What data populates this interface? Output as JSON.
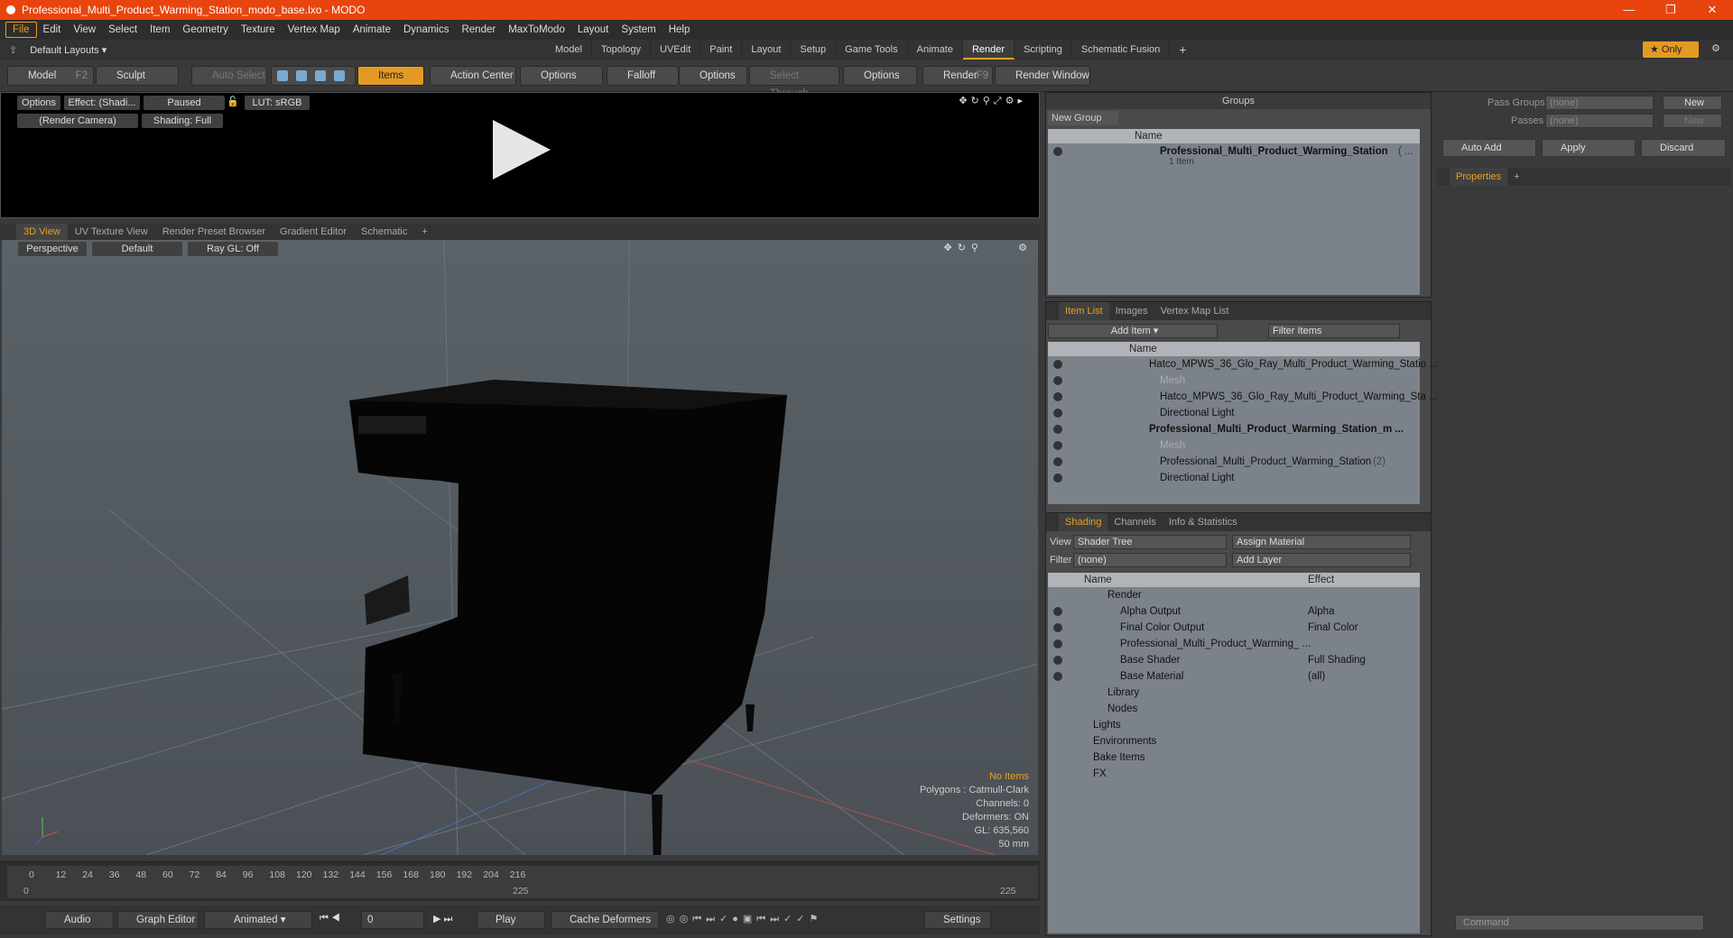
{
  "window": {
    "title": "Professional_Multi_Product_Warming_Station_modo_base.lxo - MODO"
  },
  "menu": [
    "File",
    "Edit",
    "View",
    "Select",
    "Item",
    "Geometry",
    "Texture",
    "Vertex Map",
    "Animate",
    "Dynamics",
    "Render",
    "MaxToModo",
    "Layout",
    "System",
    "Help"
  ],
  "layouts": {
    "label": "Default Layouts ▾",
    "tabs": [
      "Model",
      "Topology",
      "UVEdit",
      "Paint",
      "Layout",
      "Setup",
      "Game Tools",
      "Animate",
      "Render",
      "Scripting",
      "Schematic Fusion"
    ],
    "active": "Render",
    "only_label": "Only"
  },
  "toolbar": {
    "model": "Model",
    "model_key": "F2",
    "sculpt": "Sculpt",
    "auto_select": "Auto Select",
    "items": "Items",
    "action_center": "Action Center",
    "options1": "Options",
    "falloff": "Falloff",
    "options2": "Options",
    "select_through": "Select Through",
    "options3": "Options",
    "render": "Render",
    "render_key": "F9",
    "render_window": "Render Window"
  },
  "preview": {
    "options": "Options",
    "effect": "Effect: (Shadi...",
    "paused": "Paused",
    "lut": "LUT: sRGB",
    "camera": "(Render Camera)",
    "shading": "Shading: Full"
  },
  "viewtabs": [
    "3D View",
    "UV Texture View",
    "Render Preset Browser",
    "Gradient Editor",
    "Schematic"
  ],
  "view3d": {
    "perspective": "Perspective",
    "default": "Default",
    "raygl": "Ray GL: Off"
  },
  "stats": {
    "no_items": "No Items",
    "polygons": "Polygons : Catmull-Clark",
    "channels": "Channels: 0",
    "deformers": "Deformers: ON",
    "gl": "GL: 635,560",
    "lens": "50 mm"
  },
  "timeline": {
    "ticks": [
      "0",
      "12",
      "24",
      "36",
      "48",
      "60",
      "72",
      "84",
      "96",
      "108",
      "120",
      "132",
      "144",
      "156",
      "168",
      "180",
      "192",
      "204",
      "216"
    ],
    "start": "0",
    "mid": "225",
    "end": "225"
  },
  "bottom": {
    "audio": "Audio",
    "graph_editor": "Graph Editor",
    "animated": "Animated",
    "frame": "0",
    "play": "Play",
    "cache": "Cache Deformers",
    "settings": "Settings"
  },
  "groups": {
    "title": "Groups",
    "new_group": "New Group",
    "col_name": "Name",
    "item_name": "Professional_Multi_Product_Warming_Station",
    "item_suffix": "( ...",
    "item_count": "1 Item"
  },
  "itemlist": {
    "tabs": [
      "Item List",
      "Images",
      "Vertex Map List"
    ],
    "add_item": "Add Item",
    "filter": "Filter Items",
    "col_name": "Name",
    "rows": [
      {
        "label": "Hatco_MPWS_36_Glo_Ray_Multi_Product_Warming_Statio ...",
        "indent": 1,
        "bold": false,
        "dim": false
      },
      {
        "label": "Mesh",
        "indent": 2,
        "bold": false,
        "dim": true
      },
      {
        "label": "Hatco_MPWS_36_Glo_Ray_Multi_Product_Warming_Sta ...",
        "indent": 2,
        "bold": false,
        "dim": false
      },
      {
        "label": "Directional Light",
        "indent": 2,
        "bold": false,
        "dim": false
      },
      {
        "label": "Professional_Multi_Product_Warming_Station_m ...",
        "indent": 1,
        "bold": true,
        "dim": false
      },
      {
        "label": "Mesh",
        "indent": 2,
        "bold": false,
        "dim": true
      },
      {
        "label": "Professional_Multi_Product_Warming_Station",
        "indent": 2,
        "bold": false,
        "dim": false,
        "suffix": "(2)"
      },
      {
        "label": "Directional Light",
        "indent": 2,
        "bold": false,
        "dim": false
      }
    ]
  },
  "shading": {
    "tabs": [
      "Shading",
      "Channels",
      "Info & Statistics"
    ],
    "view_label": "View",
    "view_value": "Shader Tree",
    "assign": "Assign Material",
    "filter_label": "Filter",
    "filter_value": "(none)",
    "add_layer": "Add Layer",
    "col_name": "Name",
    "col_effect": "Effect",
    "rows": [
      {
        "name": "Render",
        "effect": "",
        "indent": 1
      },
      {
        "name": "Alpha Output",
        "effect": "Alpha",
        "indent": 2
      },
      {
        "name": "Final Color Output",
        "effect": "Final Color",
        "indent": 2
      },
      {
        "name": "Professional_Multi_Product_Warming_ ...",
        "effect": "",
        "indent": 2
      },
      {
        "name": "Base Shader",
        "effect": "Full Shading",
        "indent": 2
      },
      {
        "name": "Base Material",
        "effect": "(all)",
        "indent": 2
      },
      {
        "name": "Library",
        "effect": "",
        "indent": 1
      },
      {
        "name": "Nodes",
        "effect": "",
        "indent": 1
      },
      {
        "name": "Lights",
        "effect": "",
        "indent": 0
      },
      {
        "name": "Environments",
        "effect": "",
        "indent": 0
      },
      {
        "name": "Bake Items",
        "effect": "",
        "indent": 0
      },
      {
        "name": "FX",
        "effect": "",
        "indent": 0
      }
    ]
  },
  "passes": {
    "pass_groups": "Pass Groups",
    "passes": "Passes",
    "none": "(none)",
    "new": "New",
    "auto_add": "Auto Add",
    "apply": "Apply",
    "discard": "Discard",
    "properties": "Properties",
    "command": "Command"
  },
  "colors": {
    "accent": "#e8a020",
    "titlebar": "#e8440e"
  }
}
